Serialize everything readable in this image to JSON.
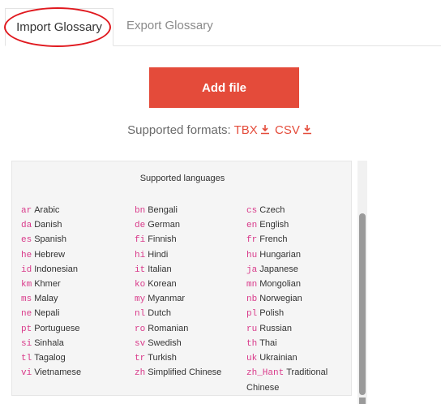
{
  "tabs": {
    "import_label": "Import Glossary",
    "export_label": "Export Glossary"
  },
  "add_file_label": "Add file",
  "formats": {
    "prefix": "Supported formats:",
    "tbx": "TBX",
    "csv": "CSV"
  },
  "languages_panel": {
    "title": "Supported languages",
    "items": [
      {
        "code": "ar",
        "name": "Arabic"
      },
      {
        "code": "bn",
        "name": "Bengali"
      },
      {
        "code": "cs",
        "name": "Czech"
      },
      {
        "code": "da",
        "name": "Danish"
      },
      {
        "code": "de",
        "name": "German"
      },
      {
        "code": "en",
        "name": "English"
      },
      {
        "code": "es",
        "name": "Spanish"
      },
      {
        "code": "fi",
        "name": "Finnish"
      },
      {
        "code": "fr",
        "name": "French"
      },
      {
        "code": "he",
        "name": "Hebrew"
      },
      {
        "code": "hi",
        "name": "Hindi"
      },
      {
        "code": "hu",
        "name": "Hungarian"
      },
      {
        "code": "id",
        "name": "Indonesian"
      },
      {
        "code": "it",
        "name": "Italian"
      },
      {
        "code": "ja",
        "name": "Japanese"
      },
      {
        "code": "km",
        "name": "Khmer"
      },
      {
        "code": "ko",
        "name": "Korean"
      },
      {
        "code": "mn",
        "name": "Mongolian"
      },
      {
        "code": "ms",
        "name": "Malay"
      },
      {
        "code": "my",
        "name": "Myanmar"
      },
      {
        "code": "nb",
        "name": "Norwegian"
      },
      {
        "code": "ne",
        "name": "Nepali"
      },
      {
        "code": "nl",
        "name": "Dutch"
      },
      {
        "code": "pl",
        "name": "Polish"
      },
      {
        "code": "pt",
        "name": "Portuguese"
      },
      {
        "code": "ro",
        "name": "Romanian"
      },
      {
        "code": "ru",
        "name": "Russian"
      },
      {
        "code": "si",
        "name": "Sinhala"
      },
      {
        "code": "sv",
        "name": "Swedish"
      },
      {
        "code": "th",
        "name": "Thai"
      },
      {
        "code": "tl",
        "name": "Tagalog"
      },
      {
        "code": "tr",
        "name": "Turkish"
      },
      {
        "code": "uk",
        "name": "Ukrainian"
      },
      {
        "code": "vi",
        "name": "Vietnamese"
      },
      {
        "code": "zh",
        "name": "Simplified Chinese"
      },
      {
        "code": "zh_Hant",
        "name": "Traditional Chinese"
      }
    ]
  },
  "colors": {
    "accent": "#e44b3a",
    "code": "#d93a8a",
    "highlight_ring": "#e0191f"
  },
  "icons": {
    "download": "download-icon"
  }
}
